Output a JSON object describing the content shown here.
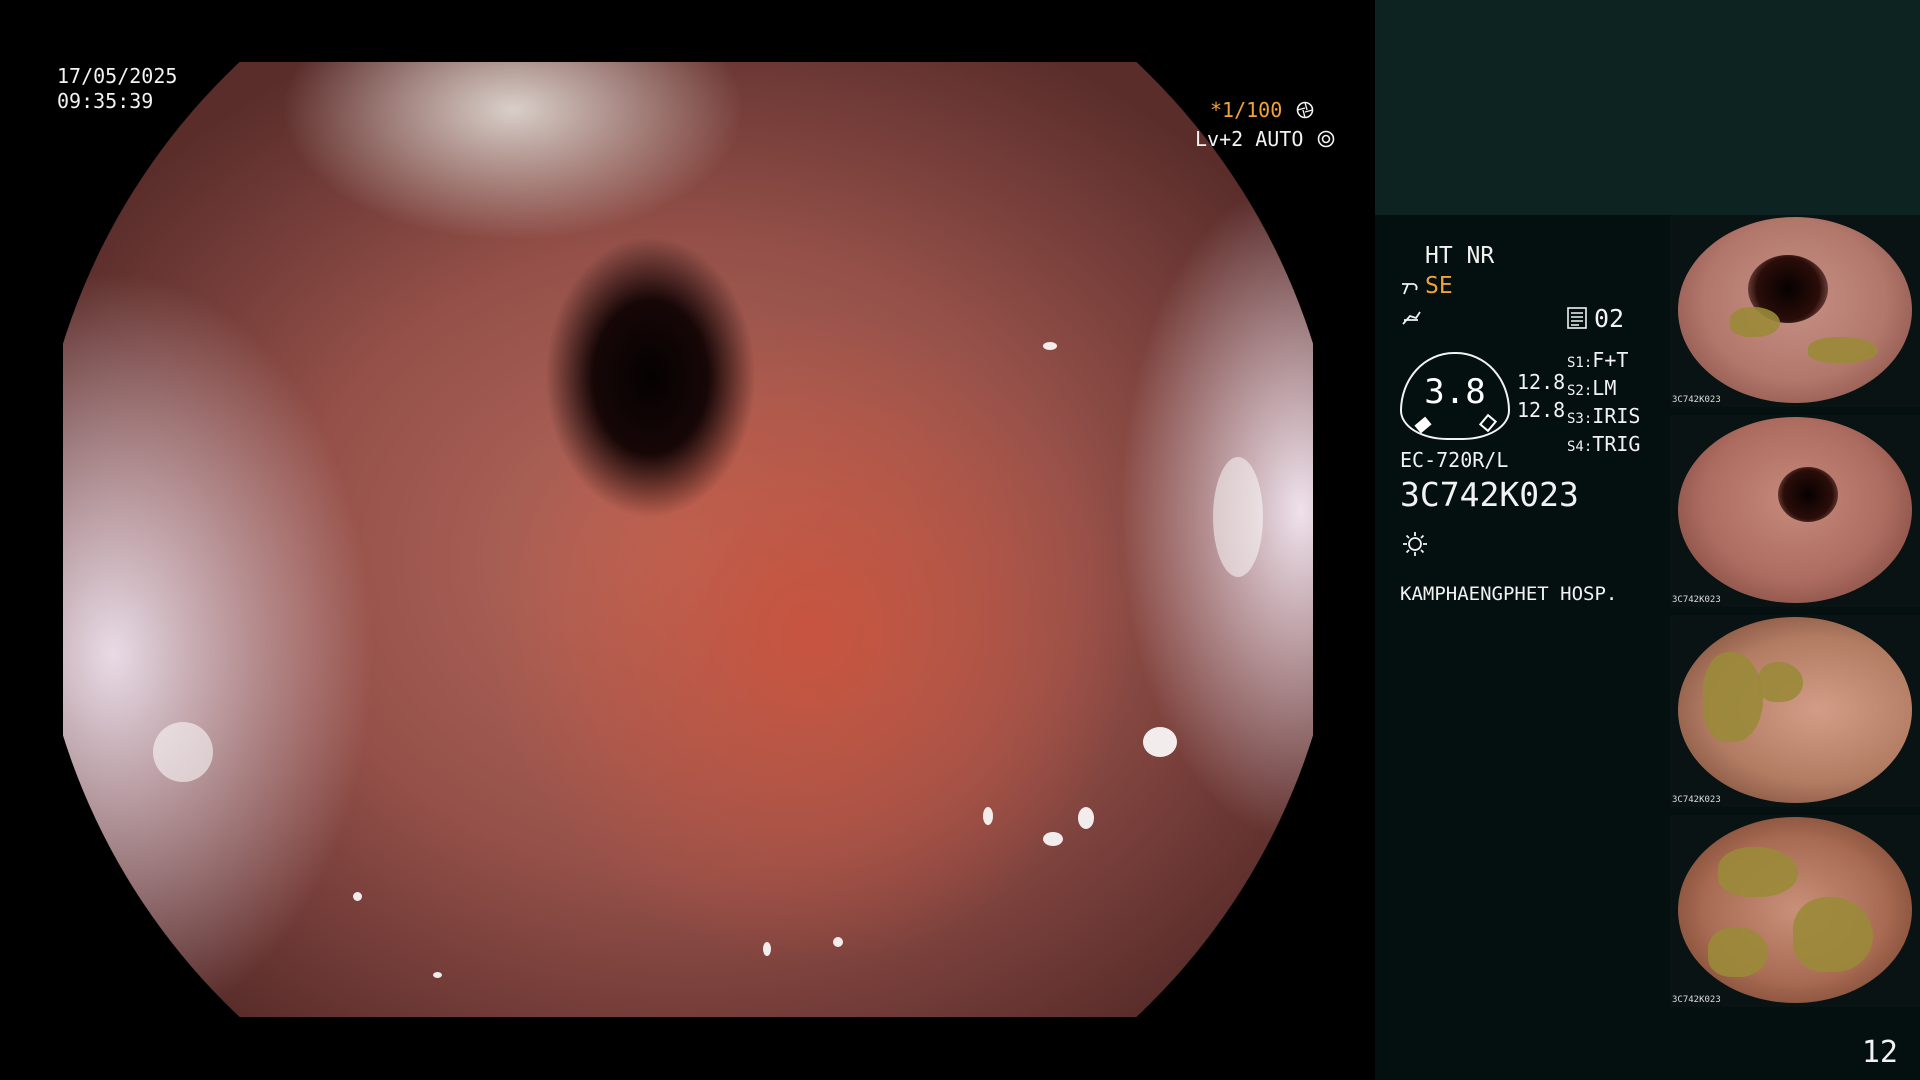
{
  "osd": {
    "date": "17/05/2025",
    "time": "09:35:39",
    "shutter": "*1/100",
    "level": "Lv+2 AUTO"
  },
  "panel": {
    "enhancement": "HT NR",
    "structure": "SE",
    "storage_count": "02",
    "gauge_value": "3.8",
    "gauge_params": [
      "12.8",
      "12.8"
    ],
    "switches": [
      {
        "key": "S1:",
        "value": "F+T"
      },
      {
        "key": "S2:",
        "value": "LM"
      },
      {
        "key": "S3:",
        "value": "IRIS"
      },
      {
        "key": "S4:",
        "value": "TRIG"
      }
    ],
    "scope_model": "EC-720R/L",
    "scope_serial": "3C742K023",
    "hospital": "KAMPHAENGPHET HOSP."
  },
  "thumbnails": [
    {
      "label": "3C742K023"
    },
    {
      "label": "3C742K023"
    },
    {
      "label": "3C742K023"
    },
    {
      "label": "3C742K023"
    }
  ],
  "page_number": "12",
  "icons": [
    "shutter-mode-icon",
    "auto-iris-icon",
    "structure-enhancement-icon",
    "color-mode-icon",
    "storage-icon",
    "light-source-icon"
  ]
}
